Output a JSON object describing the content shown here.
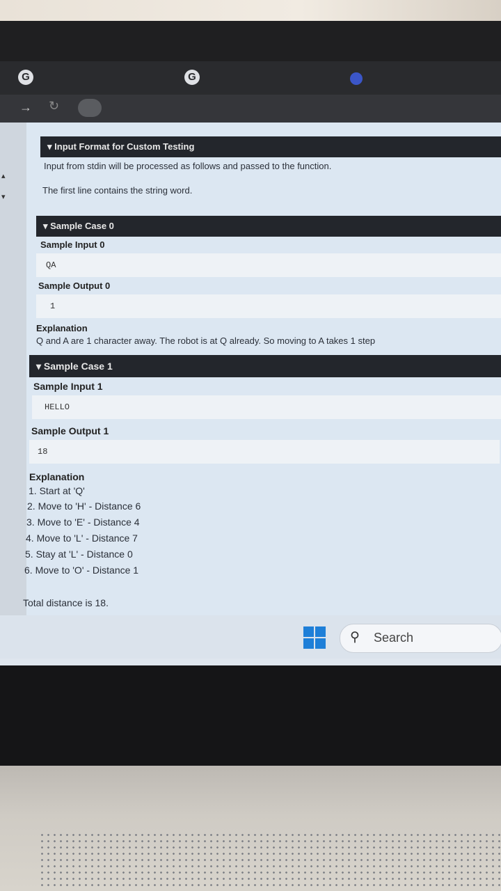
{
  "browser": {
    "tab_icon_1": "G",
    "tab_icon_2": "G"
  },
  "sections": {
    "input_format": {
      "header": "▾ Input Format for Custom Testing",
      "line1": "Input from stdin will be processed as follows and passed to the function.",
      "line2": "The first line contains the string word."
    },
    "sample0": {
      "header": "▾ Sample Case 0",
      "input_label": "Sample Input 0",
      "input_value": "QA",
      "output_label": "Sample Output 0",
      "output_value": "1",
      "explanation_label": "Explanation",
      "explanation_text": "Q and A are 1 character away. The robot is at Q already. So moving to A takes 1 step"
    },
    "sample1": {
      "header": "▾ Sample Case 1",
      "input_label": "Sample Input 1",
      "input_value": "HELLO",
      "output_label": "Sample Output 1",
      "output_value": "18",
      "explanation_label": "Explanation",
      "steps": [
        "1. Start at 'Q'",
        "2. Move to 'H' - Distance 6",
        "3. Move to 'E' - Distance 4",
        "4. Move to 'L' - Distance 7",
        "5. Stay at 'L' - Distance 0",
        "6. Move to 'O' - Distance 1"
      ],
      "total": "Total distance is 18."
    }
  },
  "taskbar": {
    "search_label": "Search",
    "search_icon": "search-icon",
    "start_icon": "windows-start-icon"
  }
}
